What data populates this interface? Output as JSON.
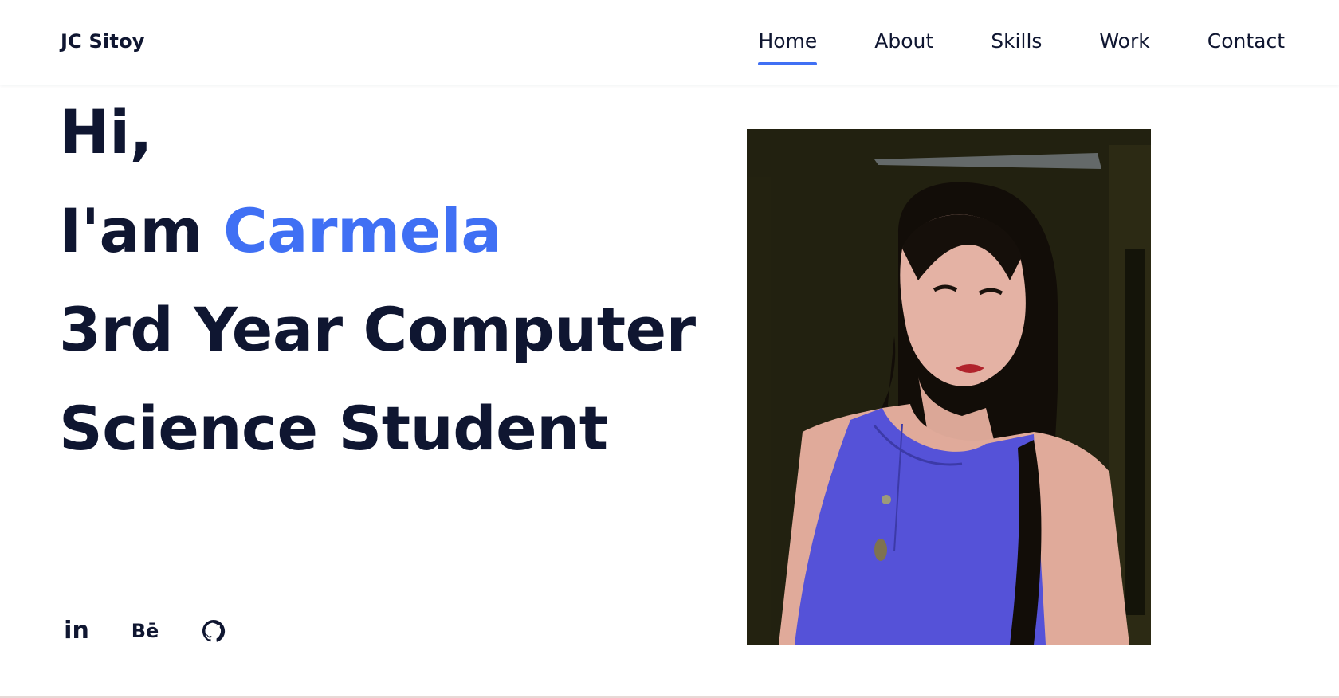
{
  "brand": {
    "name": "JC Sitoy",
    "accent_color": "#4070f4",
    "text_color": "#0f1631"
  },
  "nav": {
    "items": [
      {
        "label": "Home",
        "active": true
      },
      {
        "label": "About",
        "active": false
      },
      {
        "label": "Skills",
        "active": false
      },
      {
        "label": "Work",
        "active": false
      },
      {
        "label": "Contact",
        "active": false
      }
    ]
  },
  "hero": {
    "line1": "Hi,",
    "line2_prefix": "I'am",
    "name": "Carmela",
    "line3": "3rd Year Computer",
    "line4": "Science Student"
  },
  "socials": [
    {
      "icon": "linkedin-icon",
      "label": "in"
    },
    {
      "icon": "behance-icon",
      "label": "Bē"
    },
    {
      "icon": "github-icon",
      "label": ""
    }
  ],
  "photo": {
    "icon": "profile-photo"
  }
}
